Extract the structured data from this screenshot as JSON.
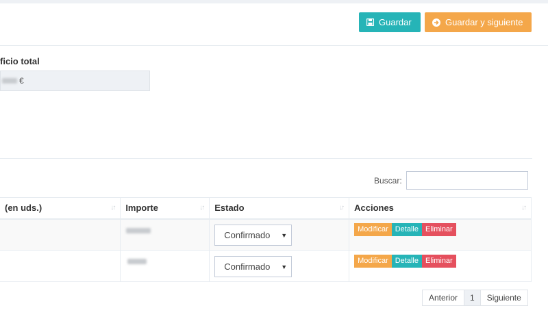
{
  "toolbar": {
    "save_label": "Guardar",
    "save_next_label": "Guardar y siguiente",
    "save_icon": "floppy-disk-icon",
    "save_next_icon": "arrow-circle-right-icon",
    "colors": {
      "save": "#26b4b7",
      "save_next": "#f4a74a"
    }
  },
  "summary": {
    "label": "ficio total",
    "currency": "€"
  },
  "search": {
    "label": "Buscar:",
    "value": ""
  },
  "table": {
    "columns": [
      "(en uds.)",
      "Importe",
      "Estado",
      "Acciones"
    ],
    "rows": [
      {
        "estado": "Confirmado",
        "actions": [
          "Modificar",
          "Detalle",
          "Eliminar"
        ]
      },
      {
        "estado": "Confirmado",
        "actions": [
          "Modificar",
          "Detalle",
          "Eliminar"
        ]
      }
    ]
  },
  "pagination": {
    "prev": "Anterior",
    "page": "1",
    "next": "Siguiente"
  }
}
